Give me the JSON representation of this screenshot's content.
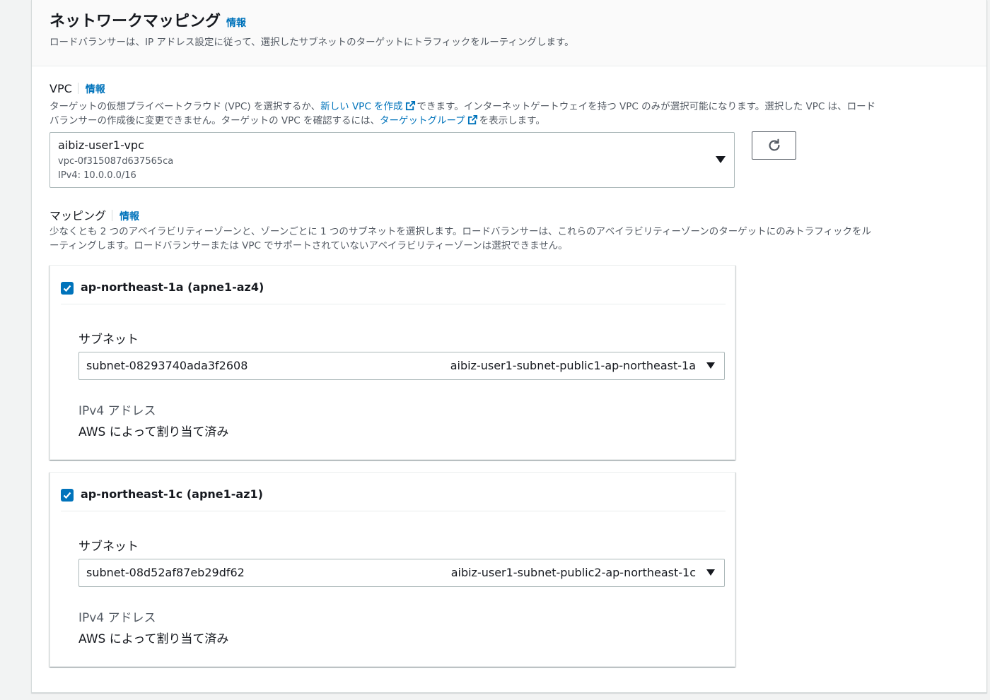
{
  "header": {
    "title": "ネットワークマッピング",
    "info": "情報",
    "description": "ロードバランサーは、IP アドレス設定に従って、選択したサブネットのターゲットにトラフィックをルーティングします。"
  },
  "vpc": {
    "label": "VPC",
    "info": "情報",
    "desc_part1": "ターゲットの仮想プライベートクラウド (VPC) を選択するか、",
    "link_new_vpc": "新しい VPC を作成",
    "desc_part2": "できます。インターネットゲートウェイを持つ VPC のみが選択可能になります。選択した VPC は、ロード",
    "desc_part3": "バランサーの作成後に変更できません。ターゲットの VPC を確認するには、",
    "link_target_group": "ターゲットグループ",
    "desc_part4": "を表示します。",
    "selected_name": "aibiz-user1-vpc",
    "selected_id": "vpc-0f315087d637565ca",
    "selected_cidr": "IPv4: 10.0.0.0/16"
  },
  "mapping": {
    "label": "マッピング",
    "info": "情報",
    "desc_line1": "少なくとも 2 つのアベイラビリティーゾーンと、ゾーンごとに 1 つのサブネットを選択します。ロードバランサーは、これらのアベイラビリティーゾーンのターゲットにのみトラフィックをル",
    "desc_line2": "ーティングします。ロードバランサーまたは VPC でサポートされていないアベイラビリティーゾーンは選択できません。",
    "zones": [
      {
        "name": "ap-northeast-1a (apne1-az4)",
        "checked": true,
        "subnet_label": "サブネット",
        "subnet_id": "subnet-08293740ada3f2608",
        "subnet_name": "aibiz-user1-subnet-public1-ap-northeast-1a",
        "ip_label": "IPv4 アドレス",
        "ip_value": "AWS によって割り当て済み"
      },
      {
        "name": "ap-northeast-1c (apne1-az1)",
        "checked": true,
        "subnet_label": "サブネット",
        "subnet_id": "subnet-08d52af87eb29df62",
        "subnet_name": "aibiz-user1-subnet-public2-ap-northeast-1c",
        "ip_label": "IPv4 アドレス",
        "ip_value": "AWS によって割り当て済み"
      }
    ]
  },
  "icons": {
    "external": "external-link-icon",
    "refresh": "refresh-icon",
    "check": "check-icon",
    "caret": "caret-down-icon"
  },
  "colors": {
    "link": "#0073bb",
    "text": "#16191f",
    "muted": "#545b64"
  }
}
